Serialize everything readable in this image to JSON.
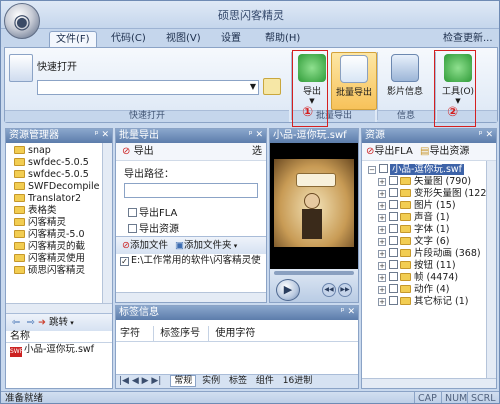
{
  "window": {
    "title": "硕思闪客精灵"
  },
  "menu_tabs": [
    "文件(F)",
    "代码(C)",
    "视图(V)",
    "设置",
    "帮助(H)"
  ],
  "check_update": "检查更新...",
  "quick_open": {
    "label": "快速打开",
    "group": "快速打开"
  },
  "ribbon_buttons": {
    "export": "导出",
    "batch_export": "批量导出",
    "movie_info": "影片信息",
    "tools": "工具(O)",
    "group_batch": "批量导出",
    "group_info": "信息"
  },
  "annotations": {
    "one": "①",
    "two": "②"
  },
  "resource_manager": {
    "title": "资源管理器",
    "items": [
      "snap",
      "swfdec-5.0.5",
      "swfdec-5.0.5",
      "SWFDecompile",
      "Translator2",
      "表格类",
      "闪客精灵",
      "闪客精灵-5.0",
      "闪客精灵的截",
      "闪客精灵使用",
      "硕思闪客精灵"
    ],
    "jump": "跳转",
    "name_header": "名称",
    "file": "小品-逗你玩.swf"
  },
  "batch_export": {
    "title": "批量导出",
    "export": "导出",
    "select": "选",
    "path_label": "导出路径：",
    "export_fla": "导出FLA",
    "export_res": "导出资源",
    "add_file": "添加文件",
    "add_folder": "添加文件夹",
    "path_item": "E:\\工作常用的软件\\闪客精灵使"
  },
  "preview": {
    "title": "小品-逗你玩.swf"
  },
  "tag_info": {
    "title": "标签信息",
    "headers": [
      "字符",
      "标签序号",
      "使用字符"
    ],
    "bottom_tabs": [
      "常规",
      "实例",
      "标签",
      "组件",
      "16进制"
    ]
  },
  "resources": {
    "title": "资源",
    "export_fla": "导出FLA",
    "export_res": "导出资源",
    "root": "小品-逗你玩.swf",
    "items": [
      "矢量图 (790)",
      "变形矢量图 (122",
      "图片 (15)",
      "声音 (1)",
      "字体 (1)",
      "文字 (6)",
      "片段动画 (368)",
      "按钮 (11)",
      "帧 (4474)",
      "动作 (4)",
      "其它标记 (1)"
    ]
  },
  "status": {
    "text": "准备就绪",
    "caps": "CAP",
    "num": "NUM",
    "scrl": "SCRL"
  }
}
